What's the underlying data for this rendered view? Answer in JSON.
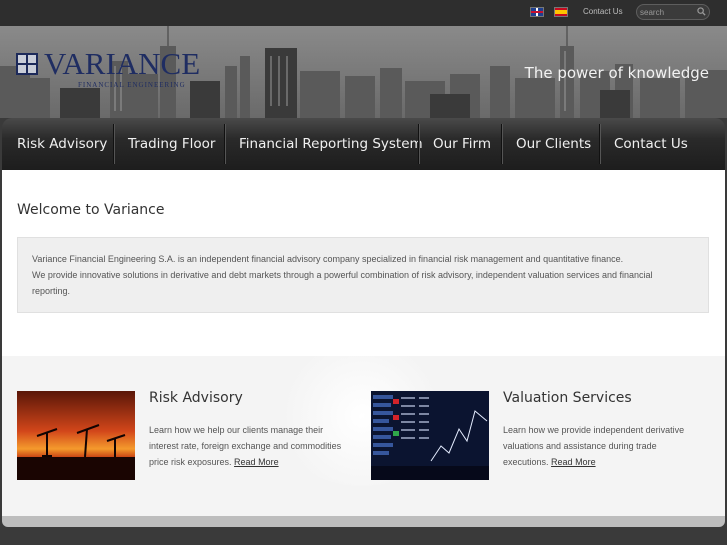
{
  "topbar": {
    "contact_label": "Contact Us",
    "search_placeholder": "search",
    "languages": [
      "en-flag-icon",
      "es-flag-icon"
    ]
  },
  "brand": {
    "name": "VARIANCE",
    "subtitle": "FINANCIAL ENGINEERING",
    "tagline": "The power of knowledge"
  },
  "nav": {
    "items": [
      {
        "label": "Risk Advisory"
      },
      {
        "label": "Trading Floor"
      },
      {
        "label": "Financial Reporting System"
      },
      {
        "label": "Our Firm"
      },
      {
        "label": "Our Clients"
      },
      {
        "label": "Contact Us"
      }
    ]
  },
  "welcome": {
    "title": "Welcome to Variance",
    "paragraph1": "Variance Financial Engineering S.A. is an independent financial advisory company specialized in financial risk management and quantitative finance.",
    "paragraph2": "We provide innovative solutions in derivative and debt markets through a powerful combination of risk advisory, independent valuation services and financial reporting."
  },
  "features": [
    {
      "title": "Risk Advisory",
      "text": "Learn how we help our clients manage their interest rate, foreign exchange and commodities price risk exposures.",
      "link": "Read More"
    },
    {
      "title": "Valuation Services",
      "text": "Learn how we provide independent derivative valuations and assistance during trade executions.",
      "link": "Read More"
    }
  ],
  "colors": {
    "brand_navy": "#1f2d62",
    "nav_bg": "#1d1d1d",
    "text_gray": "#555555"
  }
}
